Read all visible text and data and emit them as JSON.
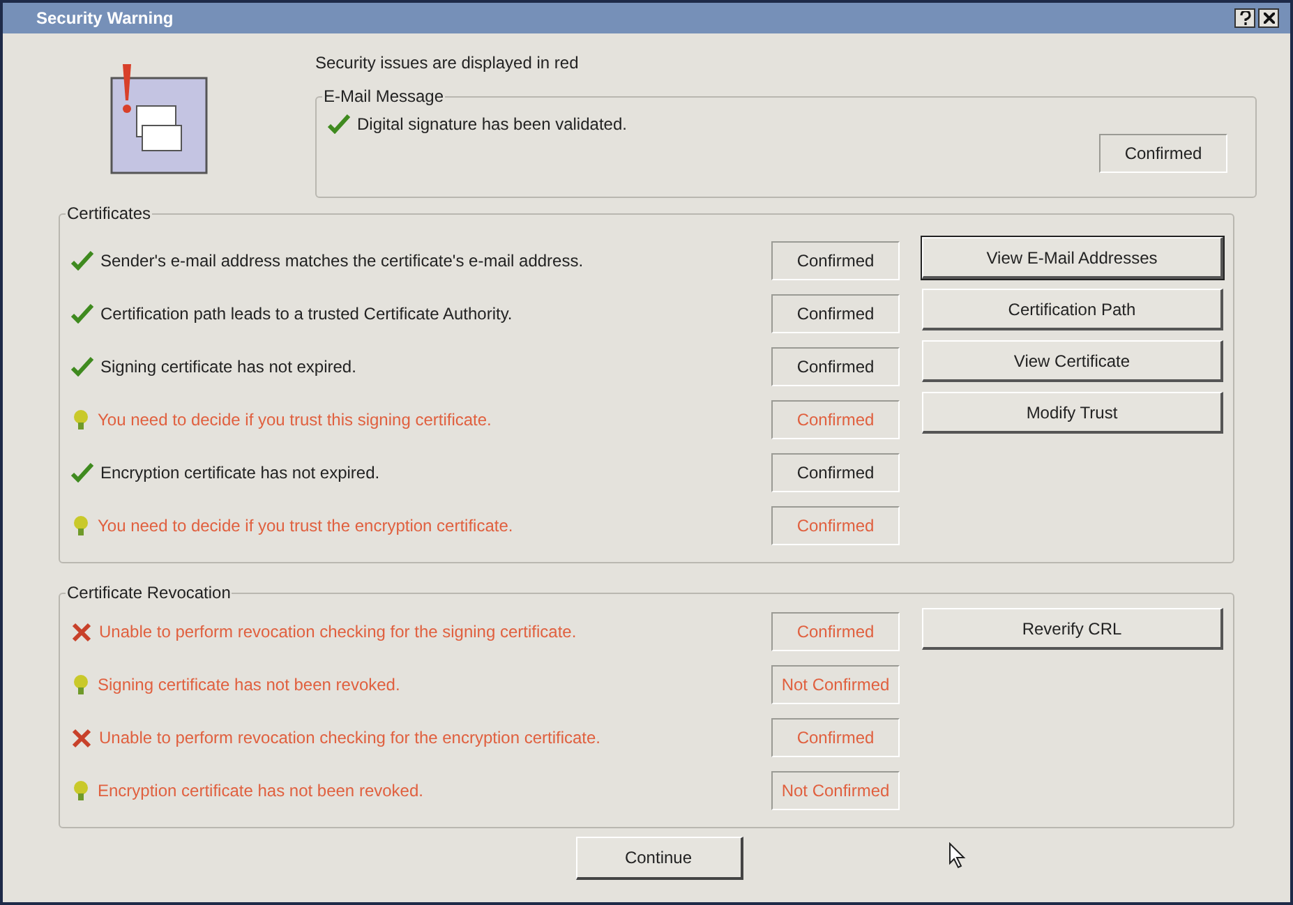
{
  "window": {
    "title": "Security Warning"
  },
  "notice": "Security issues are displayed in red",
  "email_message": {
    "label": "E-Mail Message",
    "rows": [
      {
        "kind": "check",
        "issue": false,
        "text": "Digital signature has been validated.",
        "status": "Confirmed"
      }
    ]
  },
  "certificates": {
    "label": "Certificates",
    "rows": [
      {
        "kind": "check",
        "issue": false,
        "text": "Sender's e-mail address matches the certificate's e-mail address.",
        "status": "Confirmed"
      },
      {
        "kind": "check",
        "issue": false,
        "text": "Certification path leads to a trusted Certificate Authority.",
        "status": "Confirmed"
      },
      {
        "kind": "check",
        "issue": false,
        "text": "Signing certificate has not expired.",
        "status": "Confirmed"
      },
      {
        "kind": "warning",
        "issue": true,
        "text": "You need to decide if you trust this signing certificate.",
        "status": "Confirmed"
      },
      {
        "kind": "check",
        "issue": false,
        "text": "Encryption certificate has not expired.",
        "status": "Confirmed"
      },
      {
        "kind": "warning",
        "issue": true,
        "text": "You need to decide if you trust the encryption certificate.",
        "status": "Confirmed"
      }
    ],
    "buttons": [
      {
        "label": "View E-Mail Addresses",
        "default": true
      },
      {
        "label": "Certification Path",
        "default": false
      },
      {
        "label": "View Certificate",
        "default": false
      },
      {
        "label": "Modify Trust",
        "default": false
      }
    ]
  },
  "revocation": {
    "label": "Certificate Revocation",
    "rows": [
      {
        "kind": "error",
        "issue": true,
        "text": "Unable to perform revocation checking for the signing certificate.",
        "status": "Confirmed"
      },
      {
        "kind": "warning",
        "issue": true,
        "text": "Signing certificate has not been revoked.",
        "status": "Not Confirmed"
      },
      {
        "kind": "error",
        "issue": true,
        "text": "Unable to perform revocation checking for the encryption certificate.",
        "status": "Confirmed"
      },
      {
        "kind": "warning",
        "issue": true,
        "text": "Encryption certificate has not been revoked.",
        "status": "Not Confirmed"
      }
    ],
    "buttons": [
      {
        "label": "Reverify CRL",
        "default": false
      }
    ]
  },
  "continue_button": "Continue"
}
